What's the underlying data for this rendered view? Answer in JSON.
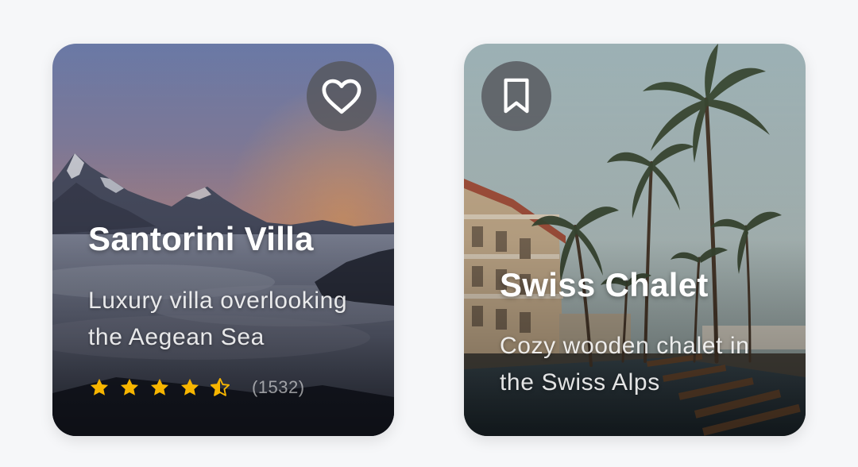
{
  "cards": [
    {
      "title": "Santorini Villa",
      "description": "Luxury villa overlooking the Aegean Sea",
      "rating": 4.5,
      "review_count": "(1532)",
      "action_icon": "heart-icon"
    },
    {
      "title": "Swiss Chalet",
      "description": "Cozy wooden chalet in the Swiss Alps",
      "action_icon": "bookmark-icon"
    }
  ],
  "colors": {
    "star": "#f7b500",
    "page_background": "#f6f7f9",
    "icon_button_background": "#55575d"
  }
}
